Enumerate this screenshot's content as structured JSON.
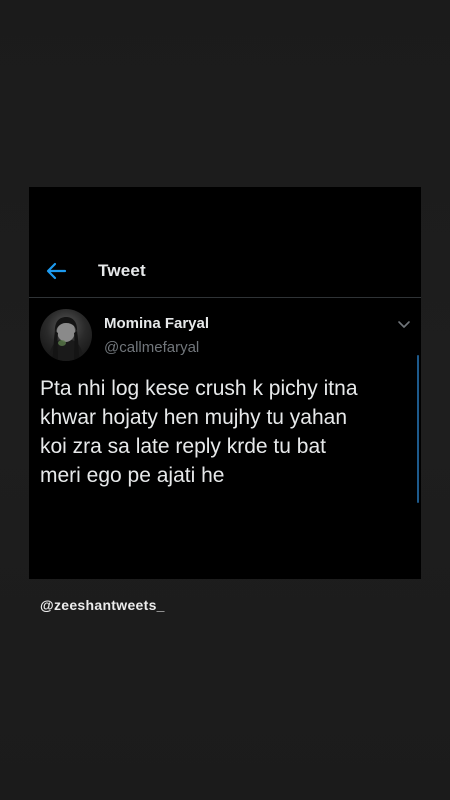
{
  "header": {
    "title": "Tweet",
    "back_icon": "arrow-left-icon"
  },
  "tweet": {
    "author_name": "Momina Faryal",
    "author_handle": "@callmefaryal",
    "text": "Pta nhi log kese crush k pichy itna\nkhwar hojaty hen mujhy tu yahan\nkoi zra sa late reply krde tu bat\nmeri ego pe ajati he",
    "menu_icon": "chevron-down-icon"
  },
  "credit": {
    "text": "@zeeshantweets_"
  },
  "colors": {
    "accent": "#1d9bf0",
    "card_bg": "#000000",
    "page_bg": "#1b1b1b",
    "text_primary": "#e7e9ea",
    "text_secondary": "#71767b"
  }
}
